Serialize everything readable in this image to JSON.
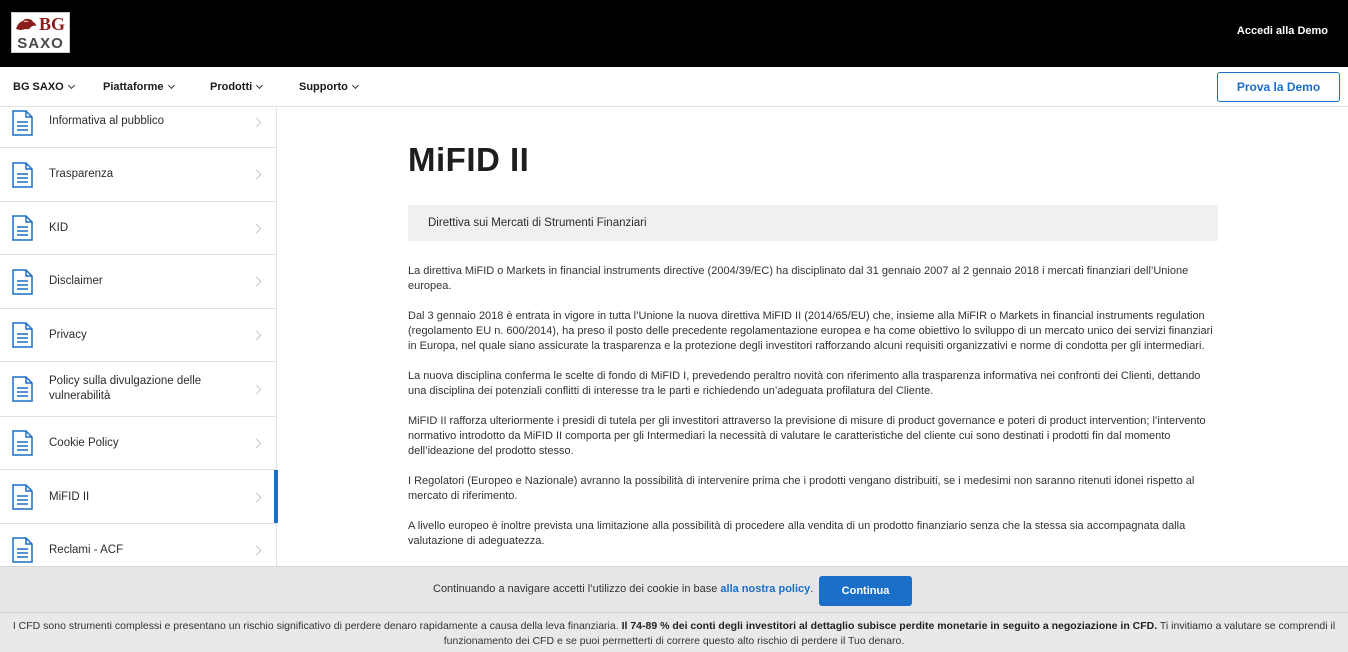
{
  "header": {
    "logo_bg": "BG",
    "logo_saxo": "SAXO",
    "demo_link": "Accedi alla Demo"
  },
  "nav": {
    "items": [
      {
        "label": "BG SAXO"
      },
      {
        "label": "Piattaforme"
      },
      {
        "label": "Prodotti"
      },
      {
        "label": "Supporto"
      }
    ],
    "try_demo": "Prova la Demo"
  },
  "sidebar": {
    "items": [
      {
        "label": "Informativa al pubblico",
        "icon": "document-icon"
      },
      {
        "label": "Trasparenza",
        "icon": "document-icon"
      },
      {
        "label": "KID",
        "icon": "document-icon"
      },
      {
        "label": "Disclaimer",
        "icon": "document-icon"
      },
      {
        "label": "Privacy",
        "icon": "document-icon"
      },
      {
        "label": "Policy sulla divulgazione delle vulnerabilità",
        "icon": "document-icon"
      },
      {
        "label": "Cookie Policy",
        "icon": "document-icon"
      },
      {
        "label": "MiFID II",
        "icon": "document-icon",
        "active": true
      },
      {
        "label": "Reclami - ACF",
        "icon": "document-icon"
      }
    ]
  },
  "main": {
    "title": "MiFID II",
    "subheading": "Direttiva sui Mercati di Strumenti Finanziari",
    "paragraphs": [
      "La direttiva MiFID o Markets in financial instruments directive (2004/39/EC) ha disciplinato dal 31 gennaio 2007 al 2 gennaio 2018 i mercati finanziari dell’Unione europea.",
      "Dal 3 gennaio 2018 è entrata in vigore in tutta l’Unione la nuova direttiva MiFID II (2014/65/EU) che, insieme alla MiFIR o Markets in financial instruments regulation (regolamento EU n. 600/2014), ha preso il posto delle precedente regolamentazione europea e ha come obiettivo lo sviluppo di un mercato unico dei servizi finanziari in Europa, nel quale siano assicurate la trasparenza e la protezione degli investitori rafforzando alcuni requisiti organizzativi e norme di condotta per gli intermediari.",
      "La nuova disciplina conferma le scelte di fondo di MiFID I, prevedendo peraltro novità con riferimento alla trasparenza informativa nei confronti dei Clienti, dettando una disciplina dei potenziali conflitti di interesse tra le parti e richiedendo un’adeguata profilatura del Cliente.",
      "MiFID II rafforza ulteriormente i presidi di tutela per gli investitori attraverso la previsione di misure di product governance e poteri di product intervention; l’intervento normativo introdotto da MiFID II comporta per gli Intermediari la necessità di valutare le caratteristiche del cliente cui sono destinati i prodotti fin dal momento dell’ideazione del prodotto stesso.",
      "I Regolatori (Europeo e Nazionale) avranno la possibilità di intervenire prima che i prodotti vengano distribuiti, se i medesimi non saranno ritenuti idonei rispetto al mercato di riferimento.",
      "A livello europeo è inoltre prevista una limitazione alla possibilità di procedere alla vendita di un prodotto finanziario senza che la stessa sia accompagnata dalla valutazione di adeguatezza."
    ]
  },
  "cookie_bar": {
    "text": "Continuando a navigare accetti l’utilizzo dei cookie in base ",
    "link": "alla nostra policy",
    "suffix": ".",
    "button": "Continua"
  },
  "risk_bar": {
    "text_start": "I CFD sono strumenti complessi e presentano un rischio significativo di perdere denaro rapidamente a causa della leva finanziaria. ",
    "text_bold": "Il 74-89 % dei conti degli investitori al dettaglio subisce perdite monetarie in seguito a negoziazione in CFD.",
    "text_end": " Ti invitiamo a valutare se comprendi il funzionamento dei CFD e se puoi permetterti di correre questo alto rischio di perdere il Tuo denaro."
  },
  "colors": {
    "accent": "#1b6fc9",
    "topbar": "#000000",
    "logo_red": "#8c1d1d"
  }
}
